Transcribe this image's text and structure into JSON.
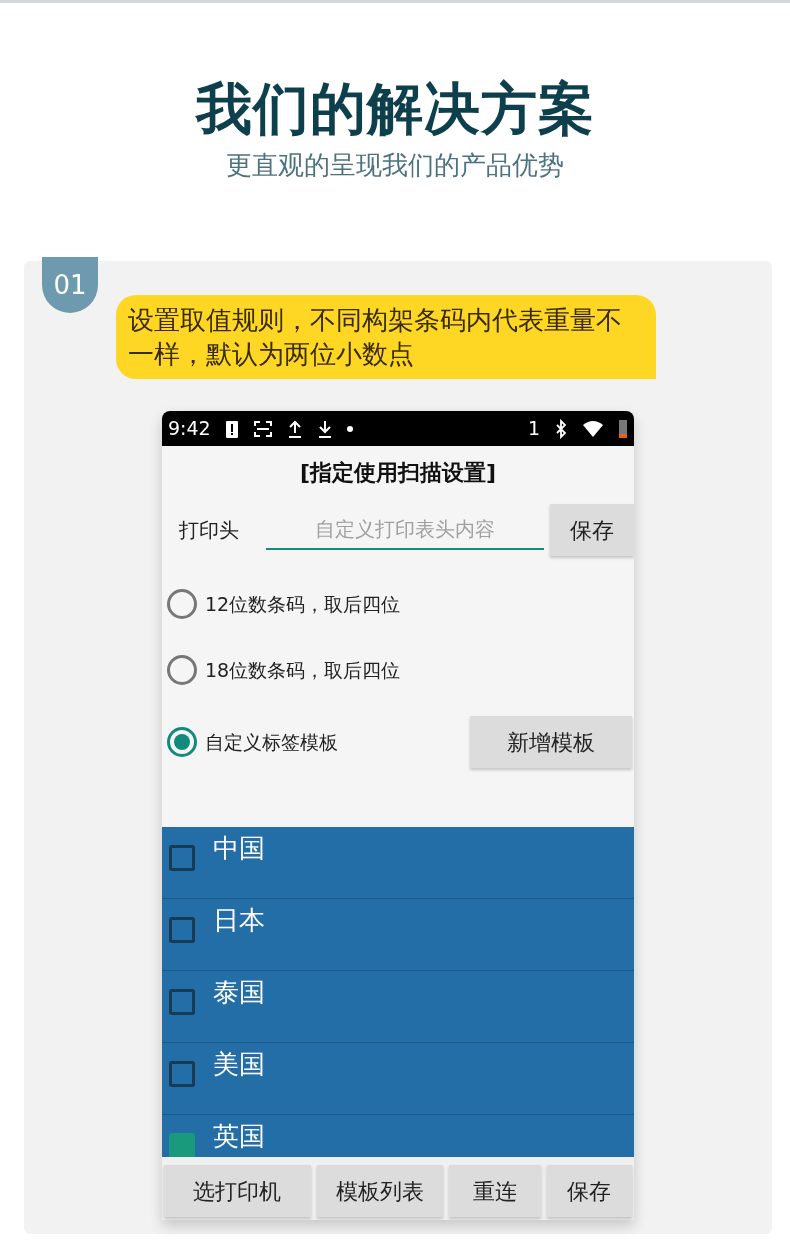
{
  "header": {
    "title": "我们的解决方案",
    "subtitle": "更直观的呈现我们的产品优势"
  },
  "step": {
    "number": "01",
    "description": "设置取值规则，不同构架条码内代表重量不一样，默认为两位小数点"
  },
  "phone": {
    "status_bar": {
      "time": "9:42",
      "sim": "1"
    },
    "title": "[指定使用扫描设置]",
    "header_field": {
      "label": "打印头",
      "placeholder": "自定义打印表头内容",
      "button": "保存"
    },
    "options": [
      {
        "label": "12位数条码，取后四位",
        "selected": false
      },
      {
        "label": "18位数条码，取后四位",
        "selected": false
      },
      {
        "label": "自定义标签模板",
        "selected": true,
        "button": "新增模板"
      }
    ],
    "list": [
      {
        "label": "中国",
        "checked": false
      },
      {
        "label": "日本",
        "checked": false
      },
      {
        "label": "泰国",
        "checked": false
      },
      {
        "label": "美国",
        "checked": false
      },
      {
        "label": "英国",
        "checked": true
      }
    ],
    "bottom_buttons": [
      "选打印机",
      "模板列表",
      "重连",
      "保存"
    ]
  }
}
